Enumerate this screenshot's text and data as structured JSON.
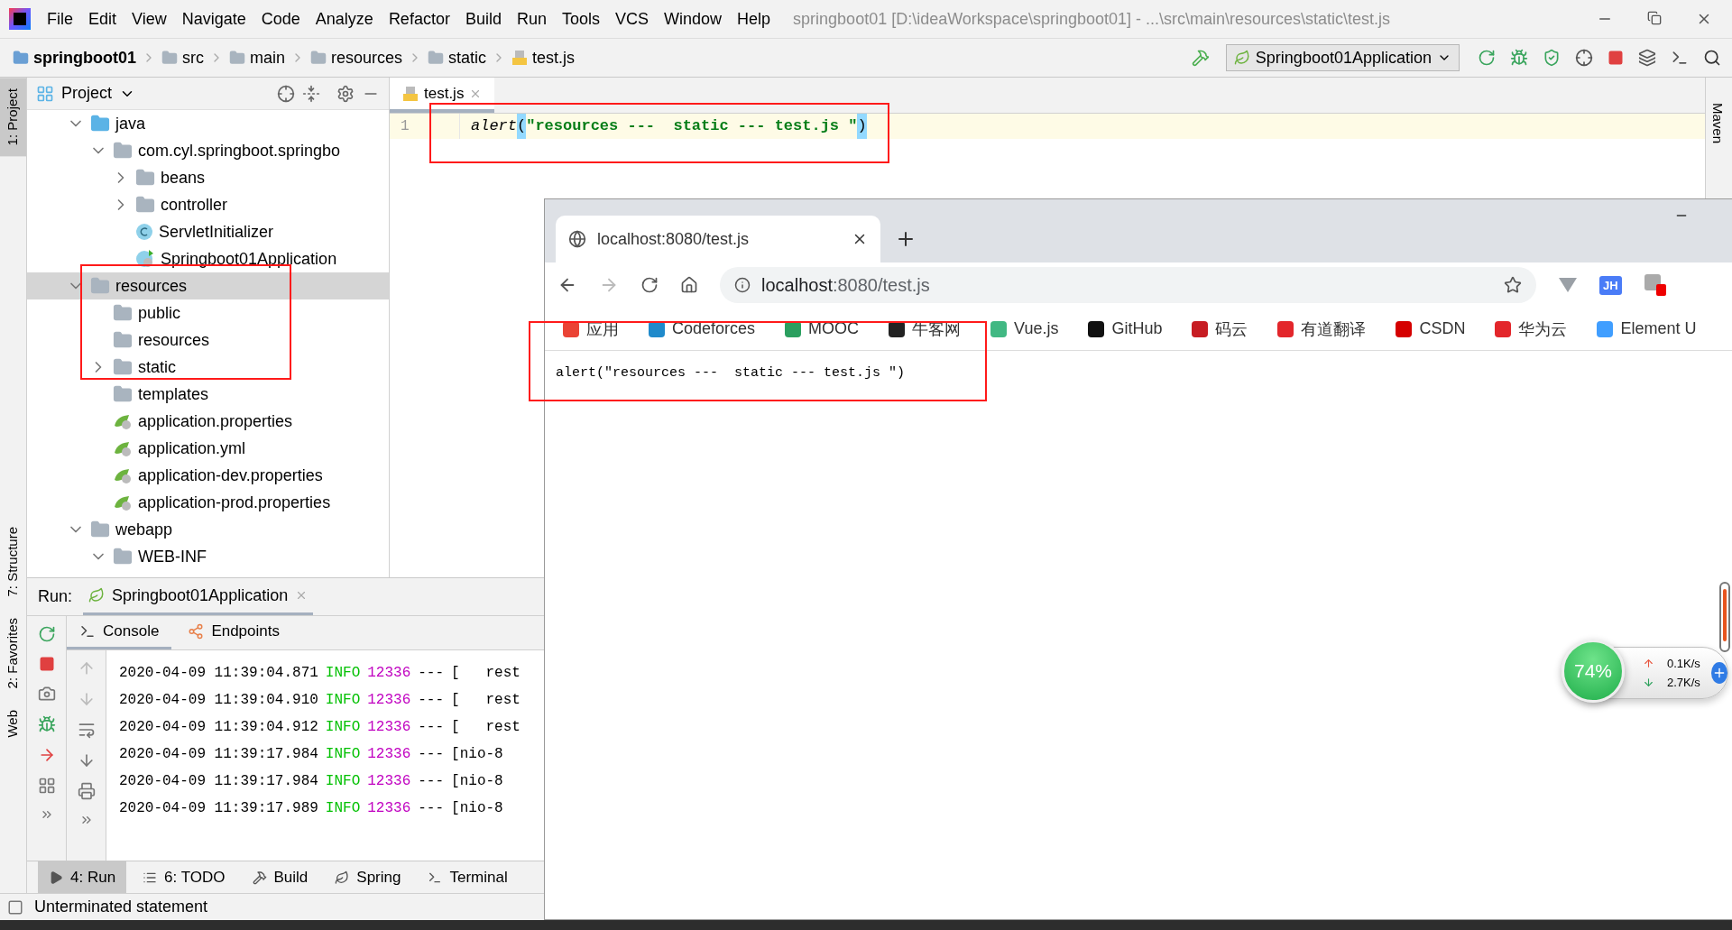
{
  "menu": [
    "File",
    "Edit",
    "View",
    "Navigate",
    "Code",
    "Analyze",
    "Refactor",
    "Build",
    "Run",
    "Tools",
    "VCS",
    "Window",
    "Help"
  ],
  "window_title": "springboot01 [D:\\ideaWorkspace\\springboot01] - ...\\src\\main\\resources\\static\\test.js",
  "breadcrumbs": [
    {
      "label": "springboot01",
      "kind": "module"
    },
    {
      "label": "src",
      "kind": "folder"
    },
    {
      "label": "main",
      "kind": "folder"
    },
    {
      "label": "resources",
      "kind": "resources"
    },
    {
      "label": "static",
      "kind": "folder"
    },
    {
      "label": "test.js",
      "kind": "js"
    }
  ],
  "run_config": "Springboot01Application",
  "left_strip": [
    {
      "label": "1: Project",
      "selected": true
    },
    {
      "label": "7: Structure",
      "selected": false
    },
    {
      "label": "2: Favorites",
      "selected": false
    },
    {
      "label": "Web",
      "selected": false
    }
  ],
  "project_panel": {
    "title": "Project"
  },
  "tree": [
    {
      "label": "java",
      "kind": "source",
      "expanded": true,
      "selected": false,
      "children": [
        {
          "label": "com.cyl.springboot.springbo",
          "kind": "package",
          "expanded": true,
          "selected": false,
          "children": [
            {
              "label": "beans",
              "kind": "package",
              "expanded": false,
              "selected": false
            },
            {
              "label": "controller",
              "kind": "package",
              "expanded": false,
              "selected": false
            },
            {
              "label": "ServletInitializer",
              "kind": "class",
              "selected": false
            },
            {
              "label": "Springboot01Application",
              "kind": "spring-class",
              "selected": false
            }
          ]
        }
      ]
    },
    {
      "label": "resources",
      "kind": "resources",
      "expanded": true,
      "selected": true,
      "children": [
        {
          "label": "public",
          "kind": "folder",
          "selected": false
        },
        {
          "label": "resources",
          "kind": "folder",
          "selected": false
        },
        {
          "label": "static",
          "kind": "folder",
          "expanded": false,
          "selected": false
        },
        {
          "label": "templates",
          "kind": "folder",
          "selected": false
        },
        {
          "label": "application.properties",
          "kind": "config",
          "selected": false
        },
        {
          "label": "application.yml",
          "kind": "config",
          "selected": false
        },
        {
          "label": "application-dev.properties",
          "kind": "config",
          "selected": false
        },
        {
          "label": "application-prod.properties",
          "kind": "config",
          "selected": false
        }
      ]
    },
    {
      "label": "webapp",
      "kind": "web",
      "expanded": true,
      "selected": false,
      "children": [
        {
          "label": "WEB-INF",
          "kind": "folder",
          "expanded": true,
          "selected": false
        }
      ]
    }
  ],
  "editor": {
    "tab": "test.js",
    "line_number": "1",
    "code": [
      {
        "kind": "fn",
        "text": "alert"
      },
      {
        "kind": "paren",
        "text": "("
      },
      {
        "kind": "string",
        "text": "\"resources ---  static --- test.js \""
      },
      {
        "kind": "paren",
        "text": ")"
      }
    ]
  },
  "right_strip": [
    "Maven"
  ],
  "run_panel": {
    "label": "Run:",
    "tab": "Springboot01Application",
    "subtabs": [
      {
        "label": "Console",
        "selected": true
      },
      {
        "label": "Endpoints",
        "selected": false
      }
    ],
    "log": [
      {
        "time": "2020-04-09 11:39:04.871",
        "level": "INFO",
        "pid": "12336",
        "sep": "---",
        "thread": "[   rest"
      },
      {
        "time": "2020-04-09 11:39:04.910",
        "level": "INFO",
        "pid": "12336",
        "sep": "---",
        "thread": "[   rest"
      },
      {
        "time": "2020-04-09 11:39:04.912",
        "level": "INFO",
        "pid": "12336",
        "sep": "---",
        "thread": "[   rest"
      },
      {
        "time": "2020-04-09 11:39:17.984",
        "level": "INFO",
        "pid": "12336",
        "sep": "---",
        "thread": "[nio-8"
      },
      {
        "time": "2020-04-09 11:39:17.984",
        "level": "INFO",
        "pid": "12336",
        "sep": "---",
        "thread": "[nio-8"
      },
      {
        "time": "2020-04-09 11:39:17.989",
        "level": "INFO",
        "pid": "12336",
        "sep": "---",
        "thread": "[nio-8"
      }
    ]
  },
  "bottom_tabs": [
    {
      "label": "4: Run",
      "kind": "run",
      "selected": true
    },
    {
      "label": "6: TODO",
      "kind": "todo",
      "selected": false
    },
    {
      "label": "Build",
      "kind": "build",
      "selected": false
    },
    {
      "label": "Spring",
      "kind": "spring",
      "selected": false
    },
    {
      "label": "Terminal",
      "kind": "terminal",
      "selected": false
    }
  ],
  "status": "Unterminated statement",
  "browser": {
    "tab_title": "localhost:8080/test.js",
    "url_host": "localhost",
    "url_rest": ":8080/test.js",
    "extension_badge": "JH",
    "bookmarks": [
      {
        "label": "应用",
        "color": "#ea4335"
      },
      {
        "label": "Codeforces",
        "color": "#1f8acb"
      },
      {
        "label": "MOOC",
        "color": "#2b9f5f"
      },
      {
        "label": "牛客网",
        "color": "#222222"
      },
      {
        "label": "Vue.js",
        "color": "#41b883"
      },
      {
        "label": "GitHub",
        "color": "#111111"
      },
      {
        "label": "码云",
        "color": "#c71d23"
      },
      {
        "label": "有道翻译",
        "color": "#e3262b"
      },
      {
        "label": "CSDN",
        "color": "#d50000"
      },
      {
        "label": "华为云",
        "color": "#e3262b"
      },
      {
        "label": "Element U",
        "color": "#409eff"
      }
    ],
    "content": "alert(\"resources ---  static --- test.js \")"
  },
  "speed_widget": {
    "percent": "74%",
    "up": "0.1K/s",
    "down": "2.7K/s"
  }
}
